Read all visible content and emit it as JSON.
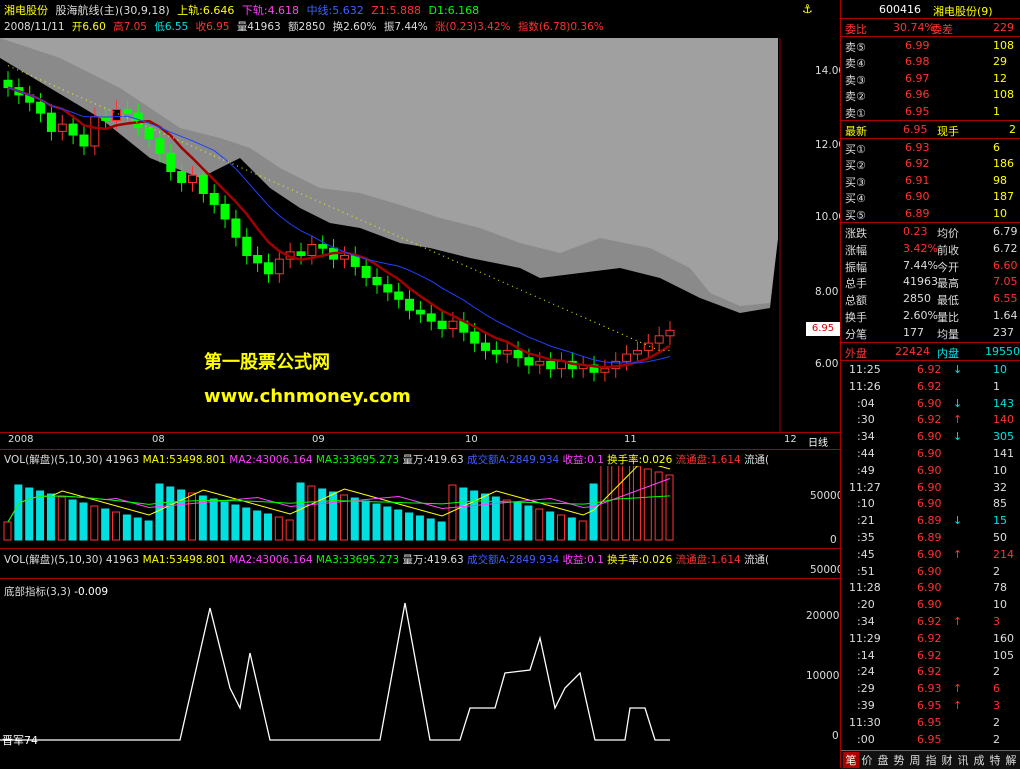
{
  "header": {
    "stock_name": "湘电股份",
    "indicator_name": "股海航线(主)(30,9,18)",
    "upper_track": "上轨:6.646",
    "lower_track": "下轨:4.618",
    "mid_track": "中线:5.632",
    "z1": "Z1:5.888",
    "d1": "D1:6.168",
    "date": "2008/11/11",
    "open": "开6.60",
    "high": "高7.05",
    "low": "低6.55",
    "close": "收6.95",
    "volume": "量41963",
    "amount": "额2850",
    "turnover": "换2.60%",
    "amplitude": "振7.44%",
    "change": "涨(0.23)3.42%",
    "index_value": "指数(6.78)0.36%"
  },
  "main_axis": {
    "labels": [
      "14.00",
      "12.00",
      "10.00",
      "8.00",
      "6.00"
    ],
    "price_tag": "6.95"
  },
  "watermark": {
    "line1": "第一股票公式网",
    "line2": "www.chnmoney.com"
  },
  "time_axis": {
    "labels": [
      "2008",
      "08",
      "09",
      "10",
      "11",
      "12"
    ],
    "period_button": "日线"
  },
  "vol_panel": {
    "name": "VOL(解盘)(5,10,30)",
    "value": "41963",
    "ma1": "MA1:53498.801",
    "ma2": "MA2:43006.164",
    "ma3": "MA3:33695.273",
    "volwan": "量万:419.63",
    "amount": "成交额A:2849.934",
    "profit": "收益:0.1",
    "turnover_rate": "换手率:0.026",
    "float_cap": "流通盘:1.614",
    "float_trunc": "流通(",
    "axis_labels": [
      "50000",
      "0"
    ]
  },
  "vol_panel2": {
    "axis_label": "50000"
  },
  "bottom_panel": {
    "name": "底部指标(3,3)",
    "value": "-0.009",
    "axis_labels": [
      "20000",
      "10000",
      "0"
    ],
    "watermark": "晋军74"
  },
  "quote": {
    "code": "600416",
    "name": "湘电股份(9)",
    "ratio_label": "委比",
    "ratio_value": "30.74%",
    "diff_label": "委差",
    "diff_value": "229",
    "asks": [
      {
        "label": "卖⑤",
        "price": "6.99",
        "vol": "108"
      },
      {
        "label": "卖④",
        "price": "6.98",
        "vol": "29"
      },
      {
        "label": "卖③",
        "price": "6.97",
        "vol": "12"
      },
      {
        "label": "卖②",
        "price": "6.96",
        "vol": "108"
      },
      {
        "label": "卖①",
        "price": "6.95",
        "vol": "1"
      }
    ],
    "latest_label": "最新",
    "latest_value": "6.95",
    "curhand_label": "现手",
    "curhand_value": "2",
    "bids": [
      {
        "label": "买①",
        "price": "6.93",
        "vol": "6"
      },
      {
        "label": "买②",
        "price": "6.92",
        "vol": "186"
      },
      {
        "label": "买③",
        "price": "6.91",
        "vol": "98"
      },
      {
        "label": "买④",
        "price": "6.90",
        "vol": "187"
      },
      {
        "label": "买⑤",
        "price": "6.89",
        "vol": "10"
      }
    ],
    "stats": [
      {
        "l1": "涨跌",
        "v1": "0.23",
        "l2": "均价",
        "v2": "6.79"
      },
      {
        "l1": "涨幅",
        "v1": "3.42%",
        "l2": "前收",
        "v2": "6.72"
      },
      {
        "l1": "振幅",
        "v1": "7.44%",
        "l2": "今开",
        "v2": "6.60"
      },
      {
        "l1": "总手",
        "v1": "41963",
        "l2": "最高",
        "v2": "7.05"
      },
      {
        "l1": "总额",
        "v1": "2850",
        "l2": "最低",
        "v2": "6.55"
      },
      {
        "l1": "换手",
        "v1": "2.60%",
        "l2": "量比",
        "v2": "1.64"
      },
      {
        "l1": "分笔",
        "v1": "177",
        "l2": "均量",
        "v2": "237"
      }
    ],
    "outer_label": "外盘",
    "outer_value": "22424",
    "inner_label": "内盘",
    "inner_value": "19550"
  },
  "ticks": [
    {
      "time": "11:25",
      "price": "6.92",
      "arrow": "↓",
      "vol": "10"
    },
    {
      "time": "11:26",
      "price": "6.92",
      "arrow": "",
      "vol": "1"
    },
    {
      "time": ":04",
      "price": "6.90",
      "arrow": "↓",
      "vol": "143"
    },
    {
      "time": ":30",
      "price": "6.92",
      "arrow": "↑",
      "vol": "140"
    },
    {
      "time": ":34",
      "price": "6.90",
      "arrow": "↓",
      "vol": "305"
    },
    {
      "time": ":44",
      "price": "6.90",
      "arrow": "",
      "vol": "141"
    },
    {
      "time": ":49",
      "price": "6.90",
      "arrow": "",
      "vol": "10"
    },
    {
      "time": "11:27",
      "price": "6.90",
      "arrow": "",
      "vol": "32"
    },
    {
      "time": ":10",
      "price": "6.90",
      "arrow": "",
      "vol": "85"
    },
    {
      "time": ":21",
      "price": "6.89",
      "arrow": "↓",
      "vol": "15"
    },
    {
      "time": ":35",
      "price": "6.89",
      "arrow": "",
      "vol": "50"
    },
    {
      "time": ":45",
      "price": "6.90",
      "arrow": "↑",
      "vol": "214"
    },
    {
      "time": ":51",
      "price": "6.90",
      "arrow": "",
      "vol": "2"
    },
    {
      "time": "11:28",
      "price": "6.90",
      "arrow": "",
      "vol": "78"
    },
    {
      "time": ":20",
      "price": "6.90",
      "arrow": "",
      "vol": "10"
    },
    {
      "time": ":34",
      "price": "6.92",
      "arrow": "↑",
      "vol": "3"
    },
    {
      "time": "11:29",
      "price": "6.92",
      "arrow": "",
      "vol": "160"
    },
    {
      "time": ":14",
      "price": "6.92",
      "arrow": "",
      "vol": "105"
    },
    {
      "time": ":24",
      "price": "6.92",
      "arrow": "",
      "vol": "2"
    },
    {
      "time": ":29",
      "price": "6.93",
      "arrow": "↑",
      "vol": "6"
    },
    {
      "time": ":39",
      "price": "6.95",
      "arrow": "↑",
      "vol": "3"
    },
    {
      "time": "11:30",
      "price": "6.95",
      "arrow": "",
      "vol": "2"
    },
    {
      "time": ":00",
      "price": "6.95",
      "arrow": "",
      "vol": "2"
    }
  ],
  "tabs": [
    "笔",
    "价",
    "盘",
    "势",
    "周",
    "指",
    "财",
    "讯",
    "成",
    "特",
    "解"
  ],
  "colors": {
    "up": "#ff3232",
    "down": "#00ff00",
    "bg": "#000000",
    "chartbg": "#a0a0a0",
    "yellow": "#ffff00",
    "axis": "#a00000",
    "cyan": "#00e0e0"
  }
}
